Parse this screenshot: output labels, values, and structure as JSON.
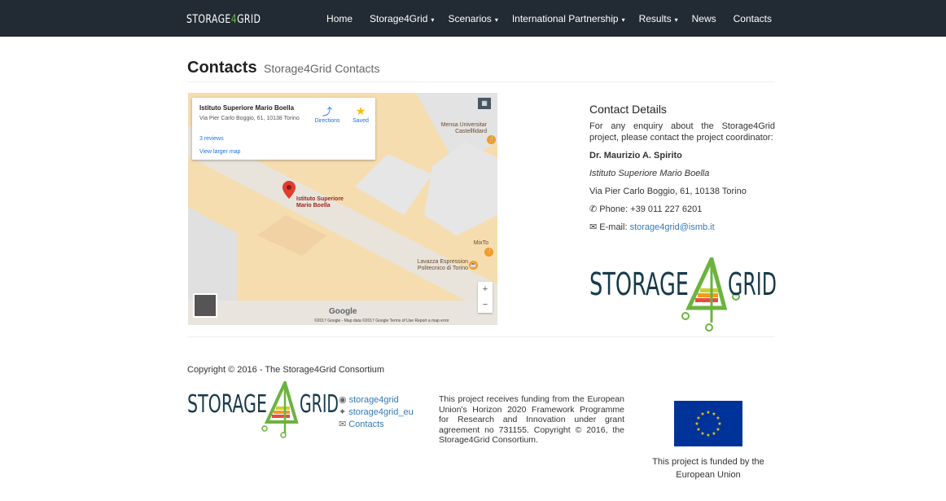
{
  "nav": {
    "brand_pre": "STORAGE",
    "brand_four": "4",
    "brand_post": "GRID",
    "items": [
      {
        "label": "Home",
        "caret": ""
      },
      {
        "label": "Storage4Grid",
        "caret": "▾"
      },
      {
        "label": "Scenarios",
        "caret": "▾"
      },
      {
        "label": "International Partnership",
        "caret": "▾"
      },
      {
        "label": "Results",
        "caret": "▾"
      },
      {
        "label": "News",
        "caret": ""
      },
      {
        "label": "Contacts",
        "caret": ""
      }
    ]
  },
  "header": {
    "title": "Contacts",
    "subtitle": "Storage4Grid Contacts"
  },
  "map": {
    "place_name": "Istituto Superiore Mario Boella",
    "address": "Via Pier Carlo Boggio, 61, 10138 Torino",
    "reviews": "3 reviews",
    "view_larger": "View larger map",
    "directions": "Directions",
    "saved": "Saved",
    "pin_label_1": "Istituto Superiore",
    "pin_label_2": "Mario Boella",
    "poi_mensa_1": "Mensa Universitar",
    "poi_mensa_2": "Castellfidard",
    "poi_mixto": "MixTo",
    "poi_lavazza_1": "Lavazza Espression",
    "poi_lavazza_2": "Politecnico di Torino",
    "zoom_in": "+",
    "zoom_out": "−",
    "google": "Google",
    "attribution": "©2017 Google - Map data ©2017 Google   Terms of Use   Report a map error"
  },
  "contact": {
    "heading": "Contact Details",
    "intro": "For any enquiry about the Storage4Grid project, please contact the project coordinator:",
    "name": "Dr. Maurizio A. Spirito",
    "institute": "Istituto Superiore Mario Boella",
    "address": "Via Pier Carlo Boggio, 61, 10138 Torino",
    "phone": "Phone: +39 011 227 6201",
    "email_label": "E-mail: ",
    "email": "storage4grid@ismb.it"
  },
  "logo": {
    "left": "STORAGE",
    "right": "GRID"
  },
  "footer": {
    "copyright": "Copyright © 2016 - The Storage4Grid Consortium",
    "link_github": "storage4grid",
    "link_twitter": "storage4grid_eu",
    "link_contacts": "Contacts",
    "funding": "This project receives funding from the European Union's Horizon 2020 Framework Programme for Research and Innovation under grant agreement no 731155. Copyright © 2016, the Storage4Grid Consortium.",
    "eu_text": "This project is funded by the European Union"
  },
  "colors": {
    "navbar": "#222b33",
    "accent_green": "#6cb33f",
    "link": "#337ab7",
    "eu_blue": "#003399"
  }
}
